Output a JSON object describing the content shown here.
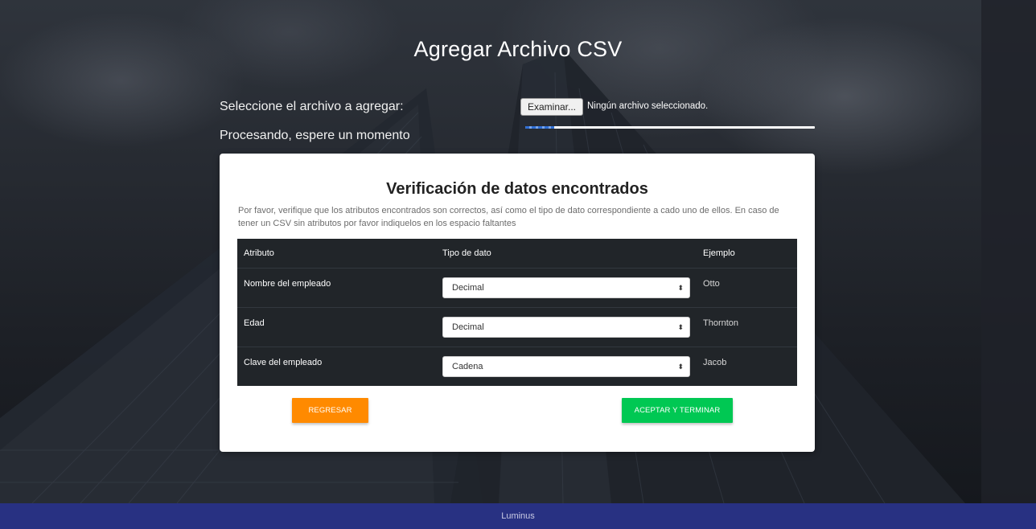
{
  "page": {
    "title": "Agregar Archivo CSV",
    "select_file_label": "Seleccione el archivo a agregar:",
    "processing_label": "Procesando, espere un momento",
    "file_input": {
      "button_label": "Examinar...",
      "status": "Ningún archivo seleccionado."
    },
    "progress": {
      "fraction": 0.1
    }
  },
  "verification": {
    "title": "Verificación de datos encontrados",
    "description": "Por favor, verifique que los atributos encontrados son correctos, así como el tipo de dato correspondiente a cado uno de ellos. En caso de tener un CSV sin atributos por favor indiquelos en los espacio faltantes",
    "table": {
      "headers": {
        "attribute": "Atributo",
        "type": "Tipo de dato",
        "example": "Ejemplo"
      },
      "rows": [
        {
          "attribute": "Nombre del empleado",
          "type": "Decimal",
          "example": "Otto"
        },
        {
          "attribute": "Edad",
          "type": "Decimal",
          "example": "Thornton"
        },
        {
          "attribute": "Clave del empleado",
          "type": "Cadena",
          "example": "Jacob"
        }
      ]
    },
    "buttons": {
      "back": "REGRESAR",
      "accept": "ACEPTAR Y TERMINAR"
    }
  },
  "footer": {
    "text": "Luminus"
  },
  "colors": {
    "accent_back": "#ff8a00",
    "accent_accept": "#00c853",
    "footer_bg": "#283182",
    "table_bg": "#212529"
  }
}
